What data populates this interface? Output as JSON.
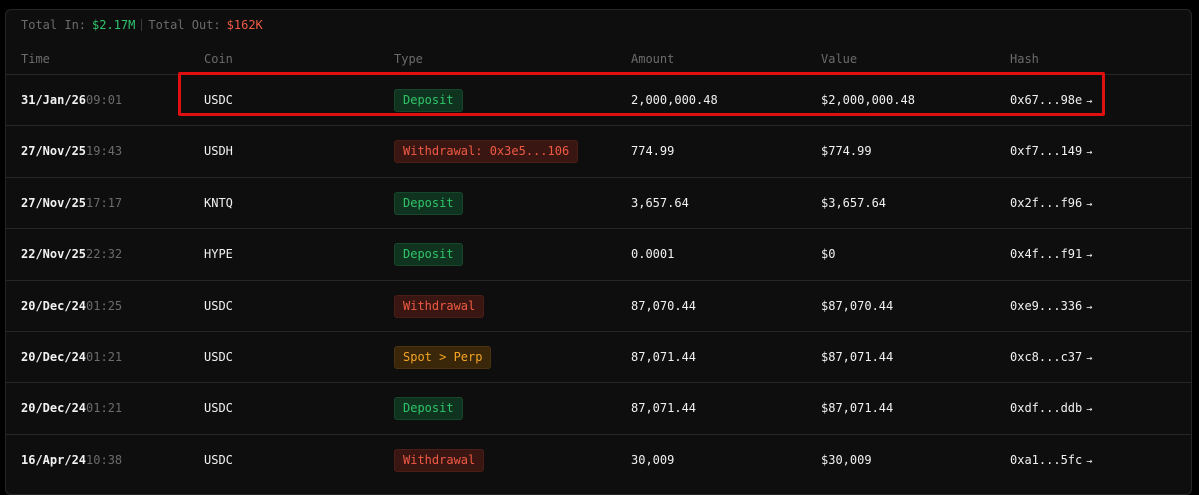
{
  "summary": {
    "total_in_label": "Total In:",
    "total_in_value": "$2.17M",
    "total_out_label": "Total Out:",
    "total_out_value": "$162K"
  },
  "columns": {
    "time": "Time",
    "coin": "Coin",
    "type": "Type",
    "amount": "Amount",
    "value": "Value",
    "hash": "Hash"
  },
  "arrow_glyph": "→",
  "colors": {
    "deposit": "#2fc46a",
    "withdrawal": "#ef5a43",
    "transfer": "#f5a623",
    "highlight": "#e01010"
  },
  "rows": [
    {
      "date": "31/Jan/26",
      "clock": "09:01",
      "coin": "USDC",
      "type": "Deposit",
      "kind": "deposit",
      "amount": "2,000,000.48",
      "value": "$2,000,000.48",
      "hash": "0x67...98e",
      "highlighted": true
    },
    {
      "date": "27/Nov/25",
      "clock": "19:43",
      "coin": "USDH",
      "type": "Withdrawal: 0x3e5...106",
      "kind": "withdrawal",
      "amount": "774.99",
      "value": "$774.99",
      "hash": "0xf7...149"
    },
    {
      "date": "27/Nov/25",
      "clock": "17:17",
      "coin": "KNTQ",
      "type": "Deposit",
      "kind": "deposit",
      "amount": "3,657.64",
      "value": "$3,657.64",
      "hash": "0x2f...f96"
    },
    {
      "date": "22/Nov/25",
      "clock": "22:32",
      "coin": "HYPE",
      "type": "Deposit",
      "kind": "deposit",
      "amount": "0.0001",
      "value": "$0",
      "hash": "0x4f...f91"
    },
    {
      "date": "20/Dec/24",
      "clock": "01:25",
      "coin": "USDC",
      "type": "Withdrawal",
      "kind": "withdrawal",
      "amount": "87,070.44",
      "value": "$87,070.44",
      "hash": "0xe9...336"
    },
    {
      "date": "20/Dec/24",
      "clock": "01:21",
      "coin": "USDC",
      "type": "Spot > Perp",
      "kind": "transfer",
      "amount": "87,071.44",
      "value": "$87,071.44",
      "hash": "0xc8...c37"
    },
    {
      "date": "20/Dec/24",
      "clock": "01:21",
      "coin": "USDC",
      "type": "Deposit",
      "kind": "deposit",
      "amount": "87,071.44",
      "value": "$87,071.44",
      "hash": "0xdf...ddb"
    },
    {
      "date": "16/Apr/24",
      "clock": "10:38",
      "coin": "USDC",
      "type": "Withdrawal",
      "kind": "withdrawal",
      "amount": "30,009",
      "value": "$30,009",
      "hash": "0xa1...5fc"
    }
  ]
}
